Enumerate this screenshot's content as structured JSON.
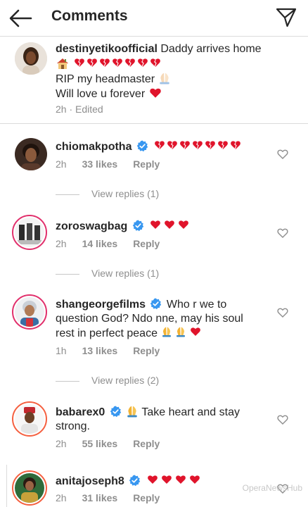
{
  "header": {
    "title": "Comments"
  },
  "caption": {
    "username": "destinyetikoofficial",
    "text_1": " Daddy arrives home",
    "text_2": "RIP my headmaster",
    "text_3": "Will love u forever",
    "meta": "2h · Edited"
  },
  "comments": [
    {
      "username": "chiomakpotha",
      "text": "",
      "time": "2h",
      "likes": "33 likes",
      "reply": "Reply",
      "view_replies": "View replies (1)"
    },
    {
      "username": "zoroswagbag",
      "text": "",
      "time": "2h",
      "likes": "14 likes",
      "reply": "Reply",
      "view_replies": "View replies (1)"
    },
    {
      "username": "shangeorgefilms",
      "text_1": " Who r we to",
      "text_2": "question God? Ndo nne, may his soul",
      "text_3": "rest in perfect peace ",
      "time": "1h",
      "likes": "13 likes",
      "reply": "Reply",
      "view_replies": "View replies (2)"
    },
    {
      "username": "babarex0",
      "text_1": " Take heart and stay",
      "text_2": "strong.",
      "time": "2h",
      "likes": "55 likes",
      "reply": "Reply"
    },
    {
      "username": "anitajoseph8",
      "time": "2h",
      "likes": "31 likes",
      "reply": "Reply"
    }
  ],
  "watermark": "OperaNewsHub",
  "icons": {
    "back": "arrow-left-icon",
    "send": "paper-plane-icon",
    "heart": "heart-outline-icon",
    "verified": "verified-badge-icon"
  },
  "colors": {
    "verified": "#3897f0",
    "heart_emoji": "#e0142b"
  }
}
